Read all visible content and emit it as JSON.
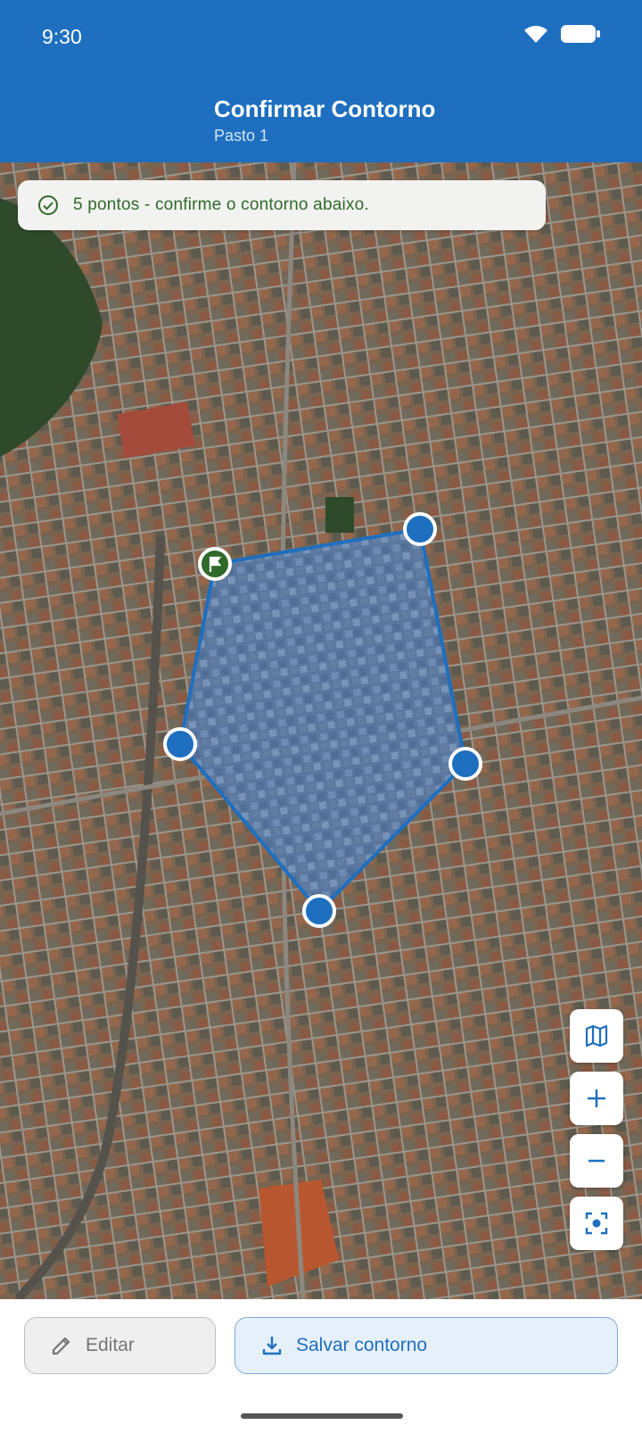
{
  "status_bar": {
    "time": "9:30"
  },
  "header": {
    "title": "Confirmar Contorno",
    "subtitle": "Pasto 1"
  },
  "banner": {
    "text": "5 pontos - confirme o contorno abaixo."
  },
  "map_controls": {
    "layers": "map-icon",
    "zoom_in": "plus-icon",
    "zoom_out": "minus-icon",
    "center": "locate-icon"
  },
  "actions": {
    "edit_label": "Editar",
    "save_label": "Salvar contorno"
  },
  "colors": {
    "primary": "#1E6FBF",
    "success": "#2F6A2A",
    "polygon_fill": "#4A7FC8"
  }
}
